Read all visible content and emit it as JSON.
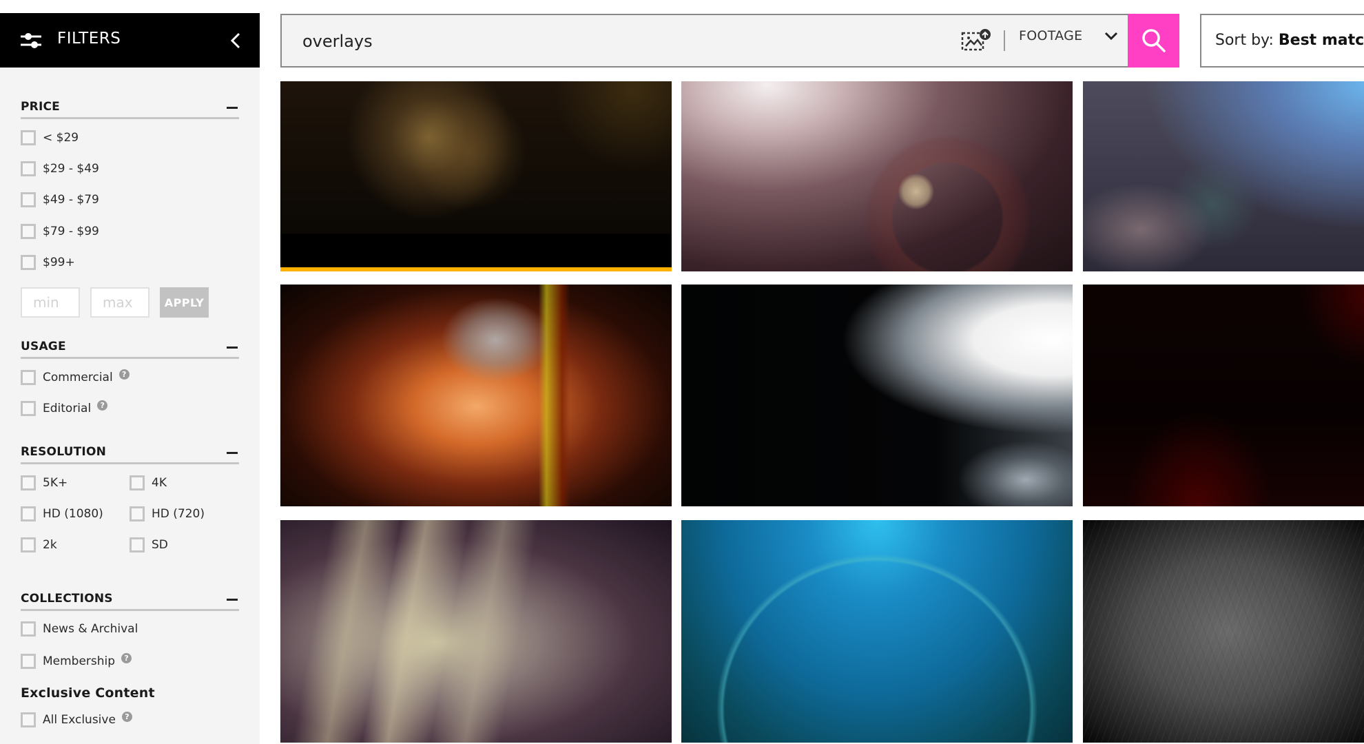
{
  "sidebar": {
    "title": "FILTERS",
    "icons": {
      "filters": "sliders-icon",
      "collapse": "chevron-left-icon"
    },
    "price": {
      "title": "PRICE",
      "options": [
        "< $29",
        "$29 - $49",
        "$49 - $79",
        "$79 - $99",
        "$99+"
      ],
      "min_placeholder": "min",
      "max_placeholder": "max",
      "apply_label": "APPLY"
    },
    "usage": {
      "title": "USAGE",
      "options": [
        {
          "label": "Commercial",
          "help": "?"
        },
        {
          "label": "Editorial",
          "help": "?"
        }
      ]
    },
    "resolution": {
      "title": "RESOLUTION",
      "options": [
        "5K+",
        "4K",
        "HD (1080)",
        "HD (720)",
        "2k",
        "SD"
      ]
    },
    "collections": {
      "title": "COLLECTIONS",
      "options": [
        {
          "label": "News & Archival"
        },
        {
          "label": "Membership",
          "help": "?"
        }
      ]
    },
    "exclusive": {
      "title": "Exclusive Content",
      "options": [
        {
          "label": "All Exclusive",
          "help": "?"
        }
      ]
    }
  },
  "search": {
    "query": "overlays",
    "media_type": "FOOTAGE",
    "icons": {
      "image_search": "image-upload-icon",
      "dropdown": "chevron-down-icon",
      "submit": "search-icon"
    }
  },
  "sort": {
    "prefix": "Sort by:",
    "value": "Best match"
  },
  "results": [
    {
      "name": "golden-bokeh-flare",
      "progress": 1.0
    },
    {
      "name": "pink-sun-lens-flare"
    },
    {
      "name": "blue-light-leak"
    },
    {
      "name": "orange-light-streak"
    },
    {
      "name": "white-light-leak-dark"
    },
    {
      "name": "dark-red-glow"
    },
    {
      "name": "cream-light-streaks"
    },
    {
      "name": "blue-anamorphic-flare"
    },
    {
      "name": "scratched-film-texture"
    }
  ],
  "colors": {
    "accent": "#ff3fc4",
    "progress": "#ffb000",
    "sidebar_bg": "#f4f4f4",
    "header_bg": "#000000"
  }
}
